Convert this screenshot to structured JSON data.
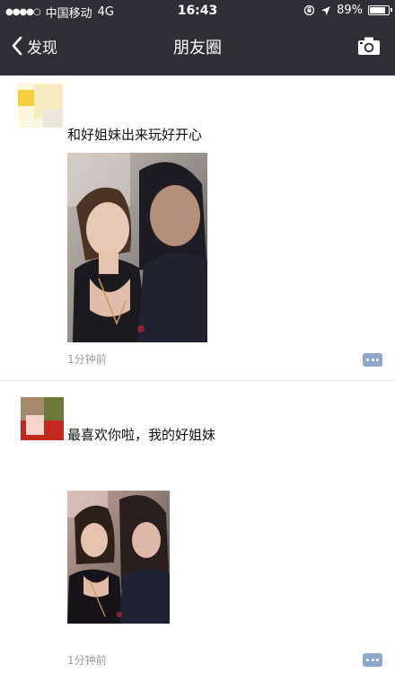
{
  "status_bar": {
    "carrier": "中国移动",
    "network": "4G",
    "time": "16:43",
    "battery_percent": "89%",
    "battery_level": 0.89
  },
  "nav": {
    "back_label": "发现",
    "title": "朋友圈",
    "camera_icon": "camera-icon"
  },
  "posts": [
    {
      "text": "和好姐妹出来玩好开心",
      "time": "1分钟前"
    },
    {
      "text": "最喜欢你啦，我的好姐妹",
      "time": "1分钟前"
    }
  ],
  "colors": {
    "nav_bg": "#2f2f35",
    "comment_button": "#8ea6c7",
    "time_text": "#999999"
  }
}
